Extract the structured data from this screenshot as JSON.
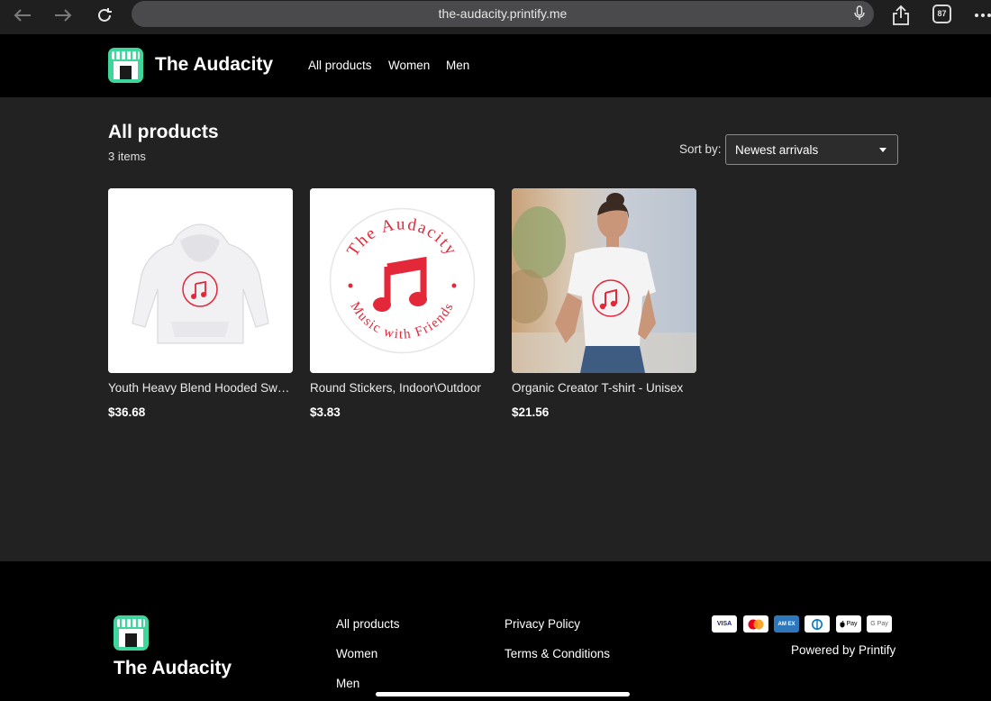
{
  "browser": {
    "url": "the-audacity.printify.me",
    "tab_count": "87"
  },
  "header": {
    "brand": "The Audacity",
    "nav": [
      "All products",
      "Women",
      "Men"
    ]
  },
  "main": {
    "title": "All products",
    "count": "3 items",
    "sort_label": "Sort by:",
    "sort_value": "Newest arrivals",
    "logo_text_top": "The Audacity",
    "logo_text_bottom": "Music with Friends",
    "products": [
      {
        "name": "Youth Heavy Blend Hooded Sweatshirt",
        "price": "$36.68"
      },
      {
        "name": "Round Stickers, Indoor\\Outdoor",
        "price": "$3.83"
      },
      {
        "name": "Organic Creator T-shirt - Unisex",
        "price": "$21.56"
      }
    ]
  },
  "footer": {
    "brand": "The Audacity",
    "links_col1": [
      "All products",
      "Women",
      "Men"
    ],
    "links_col2": [
      "Privacy Policy",
      "Terms & Conditions"
    ],
    "payments": [
      "VISA",
      "Mastercard",
      "AMEX",
      "Diners",
      "Apple Pay",
      "G Pay"
    ],
    "payment_labels": {
      "visa": "VISA",
      "amex": "AM EX",
      "apple": "Pay",
      "gpay": "G Pay"
    },
    "powered": "Powered by Printify"
  },
  "colors": {
    "page_bg": "#222222",
    "header_bg": "#000000",
    "logo_green": "#3ed69a",
    "brand_red": "#e3283a"
  }
}
